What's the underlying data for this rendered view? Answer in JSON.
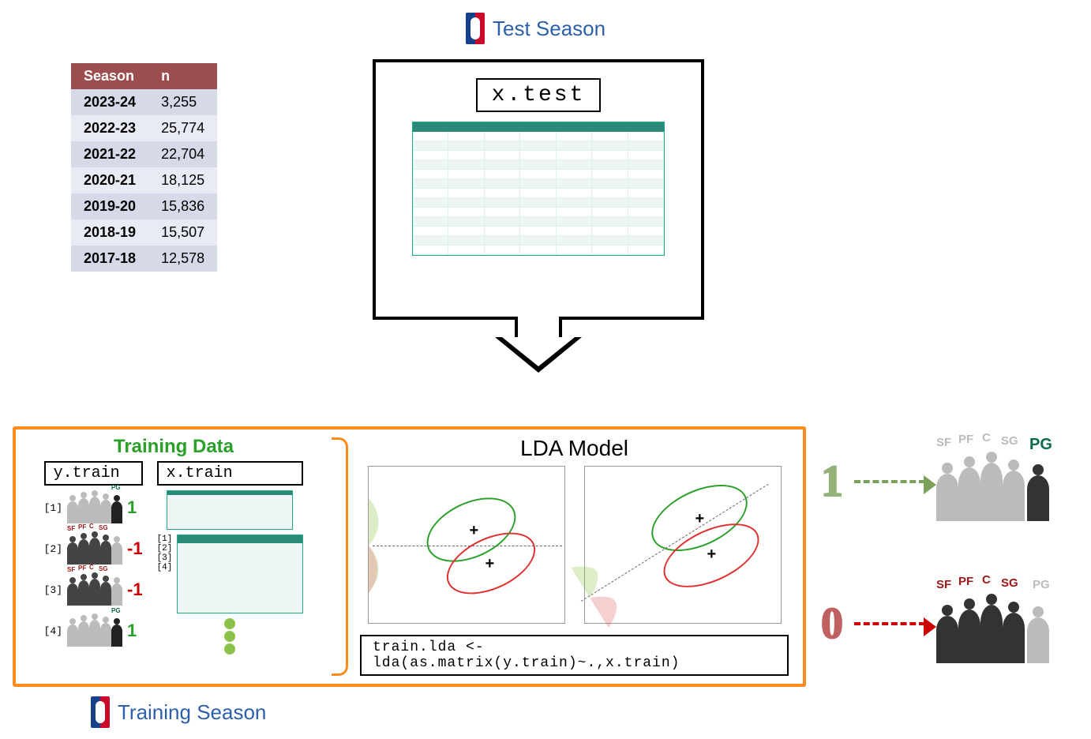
{
  "labels": {
    "test_season": "Test Season",
    "training_season": "Training Season",
    "xtest": "x.test",
    "training_data": "Training Data",
    "ytrain": "y.train",
    "xtrain": "x.train",
    "lda_model": "LDA Model",
    "code": "train.lda <- lda(as.matrix(y.train)~.,x.train)",
    "out_pos": "1",
    "out_neg": "0"
  },
  "season_table": {
    "headers": [
      "Season",
      "n"
    ],
    "rows": [
      {
        "season": "2023-24",
        "n": "3,255"
      },
      {
        "season": "2022-23",
        "n": "25,774"
      },
      {
        "season": "2021-22",
        "n": "22,704"
      },
      {
        "season": "2020-21",
        "n": "18,125"
      },
      {
        "season": "2019-20",
        "n": "15,836"
      },
      {
        "season": "2018-19",
        "n": "15,507"
      },
      {
        "season": "2017-18",
        "n": "12,578"
      }
    ]
  },
  "ytrain_rows": [
    {
      "idx": "[1]",
      "value": "1",
      "class": "pos",
      "highlight": "PG"
    },
    {
      "idx": "[2]",
      "value": "-1",
      "class": "neg",
      "highlight": "none"
    },
    {
      "idx": "[3]",
      "value": "-1",
      "class": "neg",
      "highlight": "none"
    },
    {
      "idx": "[4]",
      "value": "1",
      "class": "pos",
      "highlight": "PG"
    }
  ],
  "xtrain_idx": "[1]\n[2]\n[3]\n[4]",
  "positions": [
    "SF",
    "PF",
    "C",
    "SG",
    "PG"
  ],
  "output_positions": {
    "pos_active": "PG",
    "neg_active": [
      "SF",
      "PF",
      "C",
      "SG"
    ]
  }
}
